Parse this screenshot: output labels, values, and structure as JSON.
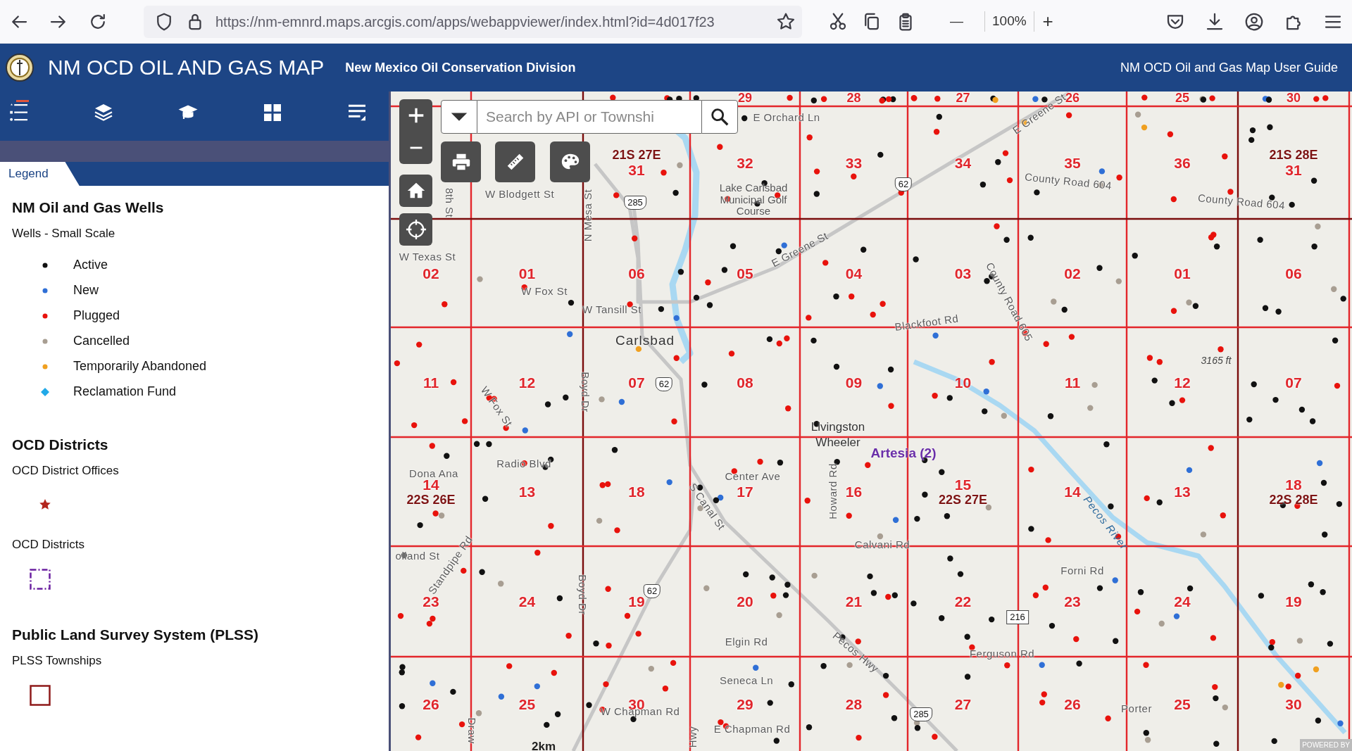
{
  "browser": {
    "url": "https://nm-emnrd.maps.arcgis.com/apps/webappviewer/index.html?id=4d017f23",
    "zoom_out": "—",
    "zoom": "100%",
    "zoom_in": "+"
  },
  "app": {
    "title": "NM OCD OIL AND GAS MAP",
    "subtitle": "New Mexico Oil Conservation Division",
    "guide_link": "NM OCD Oil and Gas Map User Guide"
  },
  "panel_tools": [
    {
      "kind": "legend",
      "selected": true
    },
    {
      "kind": "layers",
      "selected": false
    },
    {
      "kind": "cap",
      "selected": false
    },
    {
      "kind": "grid",
      "selected": false
    },
    {
      "kind": "menu",
      "selected": false
    }
  ],
  "tabs": [
    {
      "label": "Legend",
      "selected": true
    }
  ],
  "legend": [
    {
      "title": "NM Oil and Gas Wells",
      "layers": [
        {
          "name": "Wells - Small Scale",
          "items": [
            {
              "kind": "dot",
              "label": "Active",
              "color": "#111111"
            },
            {
              "kind": "dot",
              "label": "New",
              "color": "#2f6fd6"
            },
            {
              "kind": "dot",
              "label": "Plugged",
              "color": "#e8120c"
            },
            {
              "kind": "dot",
              "label": "Cancelled",
              "color": "#a89e92"
            },
            {
              "kind": "dot",
              "label": "Temporarily Abandoned",
              "color": "#f0a020"
            },
            {
              "kind": "diamond",
              "label": "Reclamation Fund",
              "color": "#21a9e8"
            }
          ]
        }
      ]
    },
    {
      "title": "OCD Districts",
      "layers": [
        {
          "name": "OCD District Offices",
          "items": [
            {
              "kind": "star",
              "color": "#b3261e"
            }
          ]
        },
        {
          "name": "OCD Districts",
          "items": [
            {
              "kind": "dashed-square",
              "color": "#6a1fa0"
            }
          ]
        }
      ]
    },
    {
      "title": "Public Land Survey System (PLSS)",
      "layers": [
        {
          "name": "PLSS Townships",
          "items": [
            {
              "kind": "square",
              "color": "#8e1a1a"
            }
          ]
        }
      ]
    }
  ],
  "map": {
    "search": {
      "placeholder": "Search by API or Townshi"
    },
    "sections": [
      {
        "cells": [
          null,
          null,
          null,
          {
            "number": "29"
          },
          {
            "number": "28"
          },
          {
            "number": "27"
          },
          {
            "number": "26"
          },
          {
            "number": "25"
          },
          {
            "number": "30"
          }
        ]
      },
      {
        "cells": [
          null,
          null,
          {
            "number": "31",
            "township": "21S 27E"
          },
          {
            "number": "32"
          },
          {
            "number": "33"
          },
          {
            "number": "34"
          },
          {
            "number": "35"
          },
          {
            "number": "36"
          },
          {
            "number": "31",
            "township": "21S 28E"
          }
        ]
      },
      {
        "cells": [
          {
            "number": "02"
          },
          {
            "number": "01"
          },
          {
            "number": "06"
          },
          {
            "number": "05"
          },
          {
            "number": "04"
          },
          {
            "number": "03"
          },
          {
            "number": "02"
          },
          {
            "number": "01"
          },
          {
            "number": "06"
          }
        ]
      },
      {
        "cells": [
          {
            "number": "11"
          },
          {
            "number": "12"
          },
          {
            "number": "07"
          },
          {
            "number": "08"
          },
          {
            "number": "09"
          },
          {
            "number": "10"
          },
          {
            "number": "11"
          },
          {
            "number": "12"
          },
          {
            "number": "07"
          }
        ]
      },
      {
        "cells": [
          {
            "number": "14",
            "township": "22S 26E"
          },
          {
            "number": "13"
          },
          {
            "number": "18"
          },
          {
            "number": "17"
          },
          {
            "number": "16"
          },
          {
            "number": "15",
            "township": "22S 27E"
          },
          {
            "number": "14"
          },
          {
            "number": "13"
          },
          {
            "number": "18",
            "township": "22S 28E"
          }
        ]
      },
      {
        "cells": [
          {
            "number": "23"
          },
          {
            "number": "24"
          },
          {
            "number": "19"
          },
          {
            "number": "20"
          },
          {
            "number": "21"
          },
          {
            "number": "22"
          },
          {
            "number": "23"
          },
          {
            "number": "24"
          },
          {
            "number": "19"
          }
        ]
      },
      {
        "cells": [
          {
            "number": "26"
          },
          {
            "number": "25"
          },
          {
            "number": "30"
          },
          {
            "number": "29"
          },
          {
            "number": "28"
          },
          {
            "number": "27"
          },
          {
            "number": "26"
          },
          {
            "number": "25"
          },
          {
            "number": "30"
          }
        ]
      }
    ],
    "labels": [
      {
        "text": "E Orchard Ln",
        "kind": "street"
      },
      {
        "text": "E Greene St",
        "kind": "street"
      },
      {
        "text": "W Blodgett St",
        "kind": "street"
      },
      {
        "text": "Lake Carlsbad Municipal Golf Course",
        "kind": "park"
      },
      {
        "text": "8th St",
        "kind": "street"
      },
      {
        "text": "N Mesa St",
        "kind": "street"
      },
      {
        "text": "County Road 604",
        "kind": "street"
      },
      {
        "text": "County Road 604",
        "kind": "street"
      },
      {
        "text": "E Greene St",
        "kind": "street"
      },
      {
        "text": "W Texas St",
        "kind": "street"
      },
      {
        "text": "W Fox St",
        "kind": "street"
      },
      {
        "text": "W Tansill St",
        "kind": "street"
      },
      {
        "text": "County Road 605",
        "kind": "street"
      },
      {
        "text": "Blackfoot Rd",
        "kind": "street"
      },
      {
        "text": "Carlsbad",
        "kind": "city"
      },
      {
        "text": "3165 ft",
        "kind": "elevation"
      },
      {
        "text": "W Fox St",
        "kind": "street"
      },
      {
        "text": "Boyd Dr",
        "kind": "street"
      },
      {
        "text": "Livingston",
        "kind": "town"
      },
      {
        "text": "Wheeler",
        "kind": "town"
      },
      {
        "text": "Artesia (2)",
        "kind": "district"
      },
      {
        "text": "Radio Blvd",
        "kind": "street"
      },
      {
        "text": "Center Ave",
        "kind": "street"
      },
      {
        "text": "Dona Ana",
        "kind": "street"
      },
      {
        "text": "S Canal St",
        "kind": "street"
      },
      {
        "text": "Howard Rd",
        "kind": "street"
      },
      {
        "text": "Pecos River",
        "kind": "water"
      },
      {
        "text": "Calvani Rd",
        "kind": "street"
      },
      {
        "text": "olland St",
        "kind": "street"
      },
      {
        "text": "Standpipe Rd",
        "kind": "street"
      },
      {
        "text": "Forni Rd",
        "kind": "street"
      },
      {
        "text": "Boyd Dr",
        "kind": "street"
      },
      {
        "text": "Elgin Rd",
        "kind": "street"
      },
      {
        "text": "Pecos Hwy",
        "kind": "street"
      },
      {
        "text": "Ferguson Rd",
        "kind": "street"
      },
      {
        "text": "Seneca Ln",
        "kind": "street"
      },
      {
        "text": "W Chapman Rd",
        "kind": "street"
      },
      {
        "text": "E Chapman Rd",
        "kind": "street"
      },
      {
        "text": "Porter",
        "kind": "street"
      },
      {
        "text": "Draw",
        "kind": "street"
      },
      {
        "text": "Hwy",
        "kind": "street"
      }
    ],
    "shields": [
      {
        "text": "285",
        "kind": "us"
      },
      {
        "text": "62",
        "kind": "us"
      },
      {
        "text": "62",
        "kind": "us"
      },
      {
        "text": "62",
        "kind": "us"
      },
      {
        "text": "216",
        "kind": "state"
      },
      {
        "text": "285",
        "kind": "us"
      }
    ],
    "scale_bar": "2km",
    "attribution": "POWERED BY"
  }
}
